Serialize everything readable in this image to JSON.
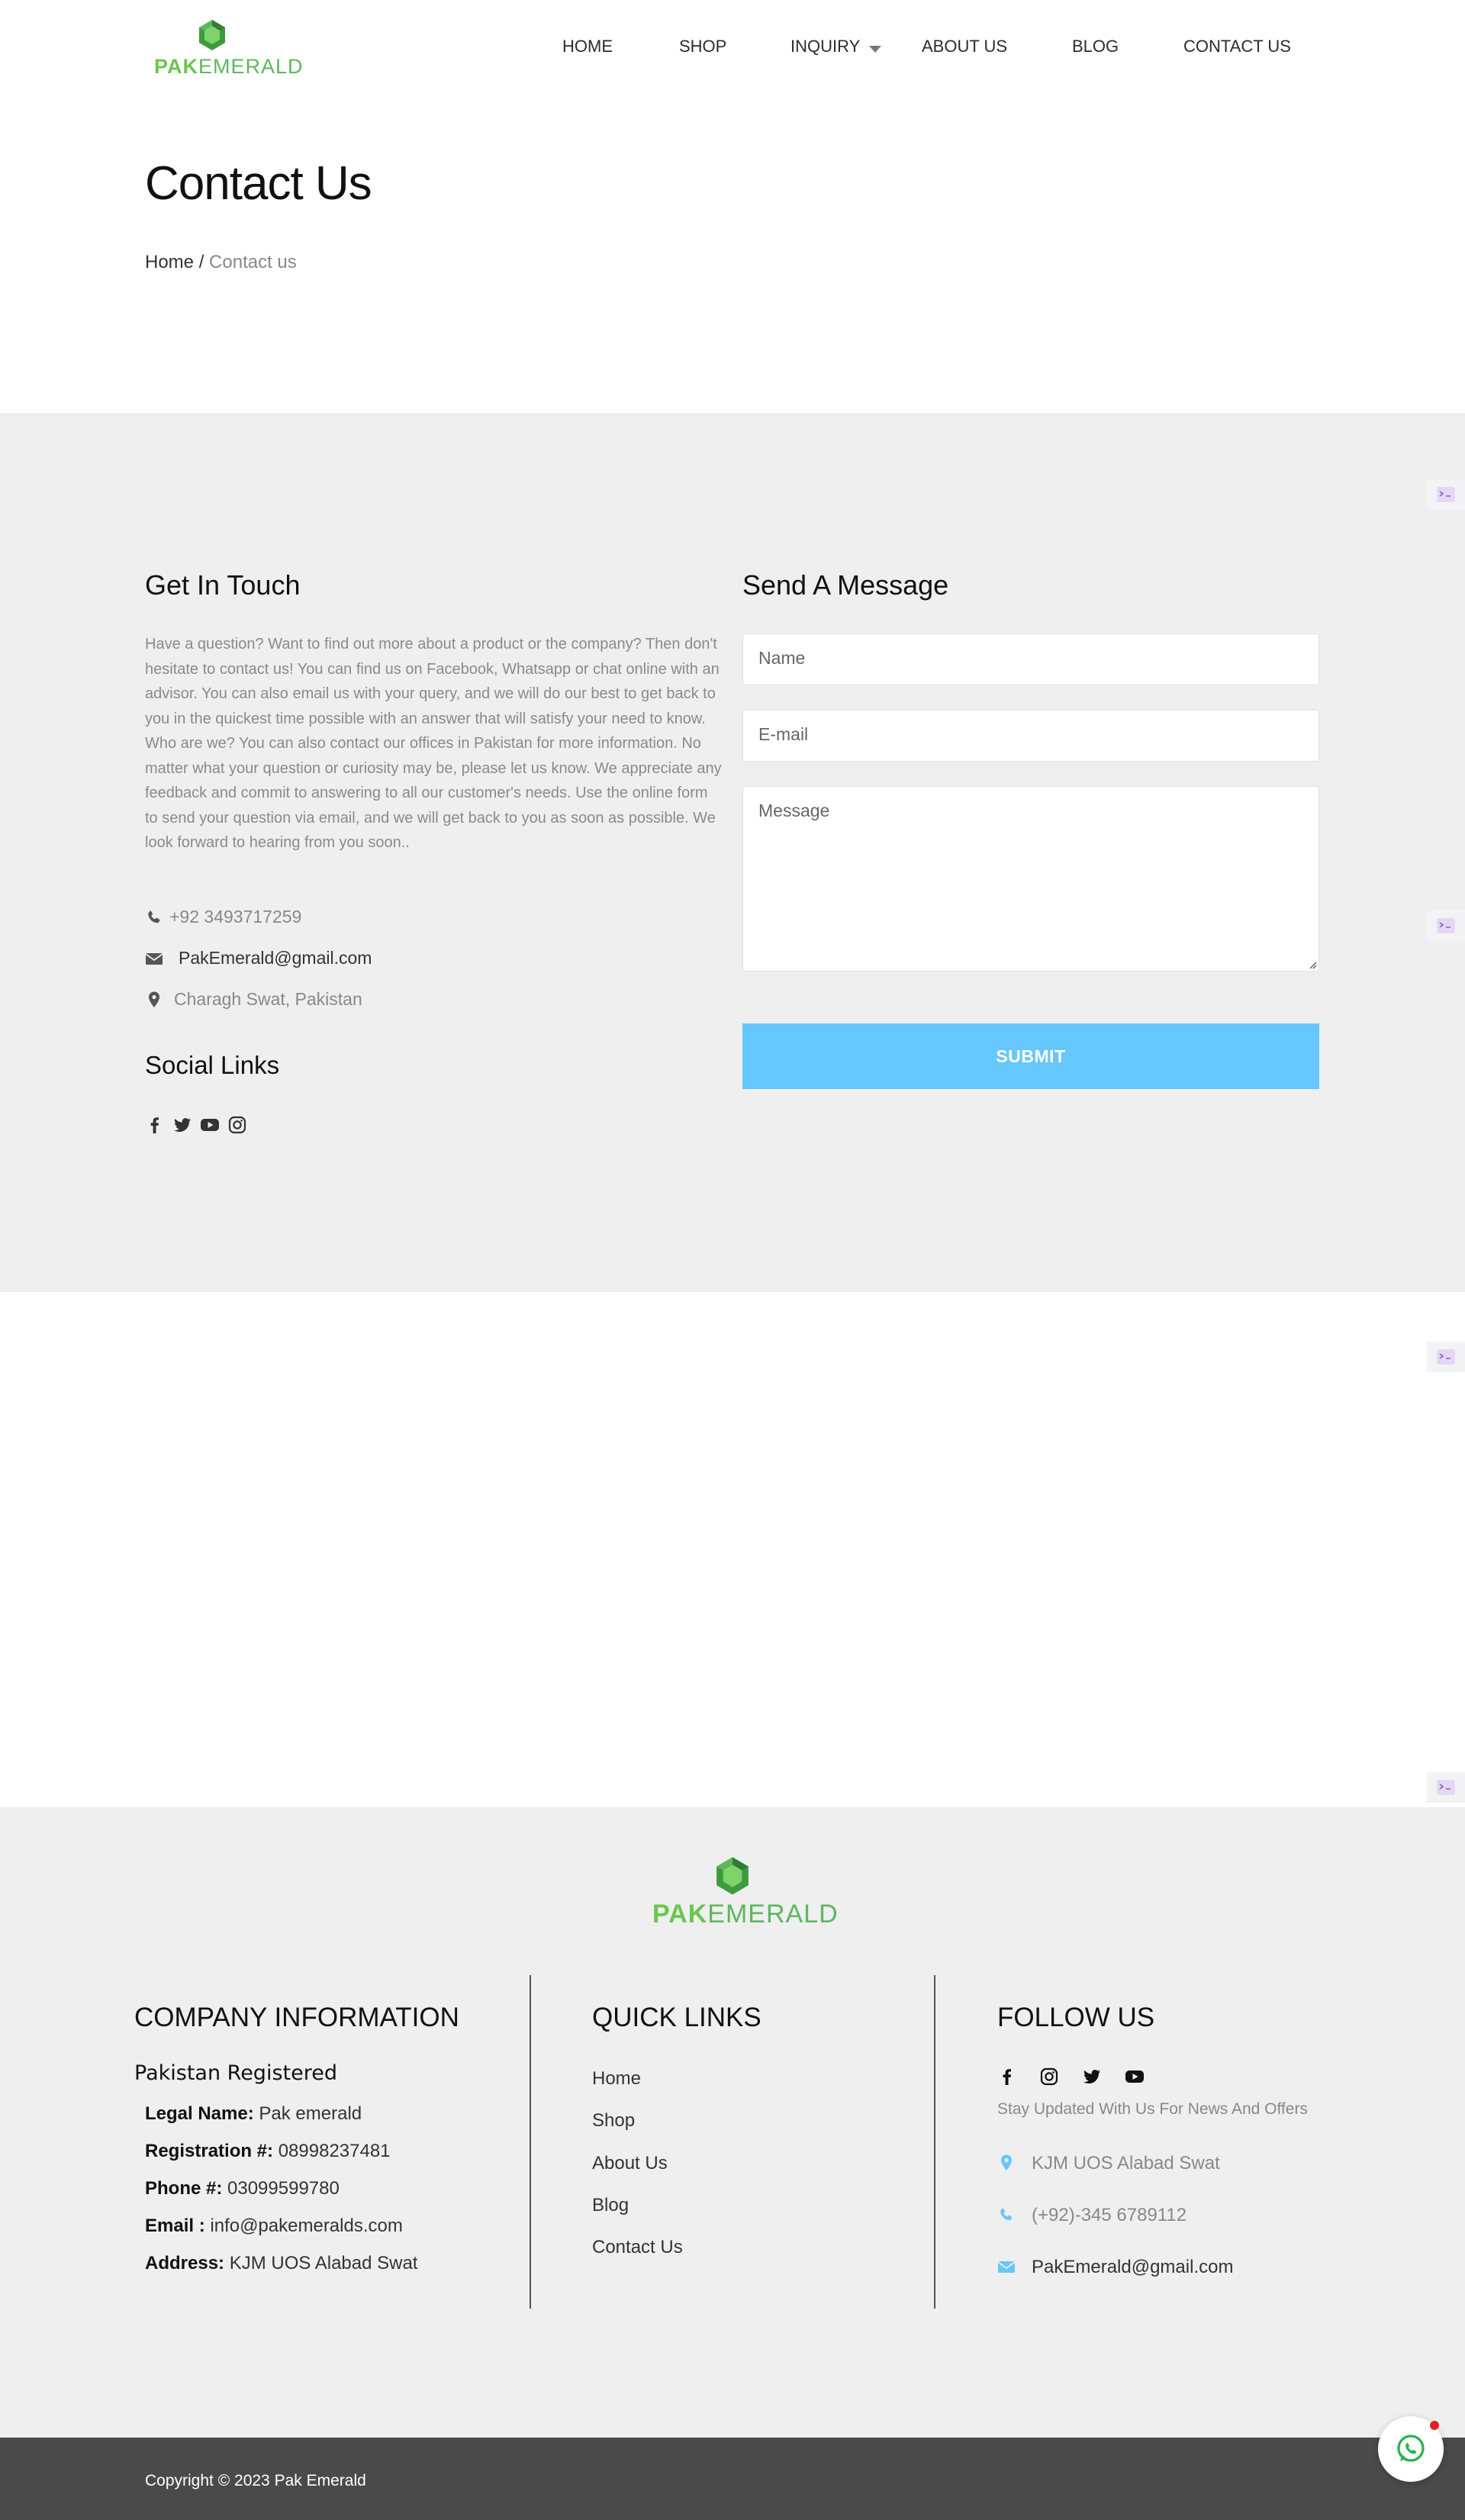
{
  "brand": {
    "logo_bold": "PAK",
    "logo_rest": "EMERALD",
    "logo_color": "#6cc64c"
  },
  "nav": {
    "items": [
      {
        "label": "HOME"
      },
      {
        "label": "SHOP"
      },
      {
        "label": "INQUIRY"
      },
      {
        "label": "ABOUT US"
      },
      {
        "label": "BLOG"
      },
      {
        "label": "CONTACT US"
      }
    ]
  },
  "page": {
    "title": "Contact Us",
    "breadcrumb": {
      "home": "Home",
      "separator": " / ",
      "current": "Contact us"
    }
  },
  "get_in_touch": {
    "title": "Get In Touch",
    "intro": "Have a question? Want to find out more about a product or the company? Then don't hesitate to contact us! You can find us on Facebook, Whatsapp or chat online with an advisor. You can also email us with your query, and we will do our best to get back to you in the quickest time possible with an answer that will satisfy your need to know. Who are we? You can also contact our offices in Pakistan for more information. No matter what your question or curiosity may be, please let us know. We appreciate any feedback and commit to answering to all our customer's needs. Use the online form to send your question via email, and we will get back to you as soon as possible. We look forward to hearing from you soon..",
    "phone": "+92 3493717259",
    "email": "PakEmerald@gmail.com",
    "address": "Charagh Swat, Pakistan",
    "social_title": "Social Links",
    "social_icons": [
      "facebook-icon",
      "twitter-icon",
      "youtube-icon",
      "instagram-icon"
    ]
  },
  "message_form": {
    "title": "Send A Message",
    "name_placeholder": "Name",
    "email_placeholder": "E-mail",
    "message_placeholder": "Message",
    "submit_label": "SUBMIT",
    "accent": "#66c7fc"
  },
  "footer": {
    "company": {
      "title": "COMPANY INFORMATION",
      "subtitle": "Pakistan Registered",
      "rows": [
        {
          "label": "Legal Name:",
          "value": "Pak emerald"
        },
        {
          "label": "Registration #:",
          "value": "08998237481"
        },
        {
          "label": "Phone #:",
          "value": "03099599780"
        },
        {
          "label": "Email :",
          "value": "info@pakemeralds.com"
        },
        {
          "label": "Address:",
          "value": "KJM UOS Alabad Swat"
        }
      ]
    },
    "quick_links": {
      "title": "QUICK LINKS",
      "items": [
        "Home",
        "Shop",
        "About Us",
        "Blog",
        "Contact Us"
      ]
    },
    "follow": {
      "title": "FOLLOW US",
      "icons": [
        "facebook-icon",
        "instagram-icon",
        "twitter-icon",
        "youtube-icon"
      ],
      "tagline": "Stay Updated With Us For News And Offers",
      "address": "KJM UOS Alabad Swat",
      "phone": "(+92)-345 6789112",
      "email": "PakEmerald@gmail.com",
      "icon_color": "#66c7fc"
    },
    "copyright": "Copyright © 2023 Pak Emerald"
  }
}
